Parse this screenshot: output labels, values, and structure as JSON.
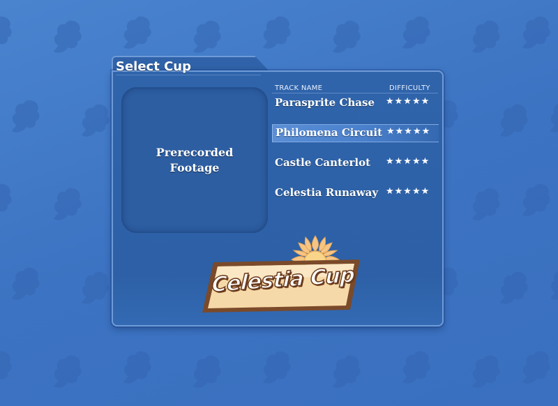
{
  "cup_screen": {
    "title": "Select Cup",
    "preview_text": "Prerecorded Footage",
    "columns": {
      "track_name": "TRACK NAME",
      "difficulty": "DIFFICULTY"
    },
    "selected_index": 1,
    "tracks": [
      {
        "name": "Parasprite Chase",
        "difficulty": "★★★★★",
        "difficulty_rating": 5
      },
      {
        "name": "Philomena Circuit",
        "difficulty": "★★★★★",
        "difficulty_rating": 5
      },
      {
        "name": "Castle Canterlot",
        "difficulty": "★★★★★",
        "difficulty_rating": 5
      },
      {
        "name": "Celestia Runaway",
        "difficulty": "★★★★★",
        "difficulty_rating": 5
      }
    ],
    "cup_logo": {
      "text": "Celestia Cup",
      "icon": "sun-icon"
    }
  },
  "colors": {
    "background": "#3f78c6",
    "panel": "#2f62a8",
    "panel_border": "#6f9bd8",
    "selected_row": "#5b8fd6",
    "logo_frame": "#7a4a2a",
    "logo_fill": "#f6d9a8",
    "sun": "#f8c878"
  }
}
